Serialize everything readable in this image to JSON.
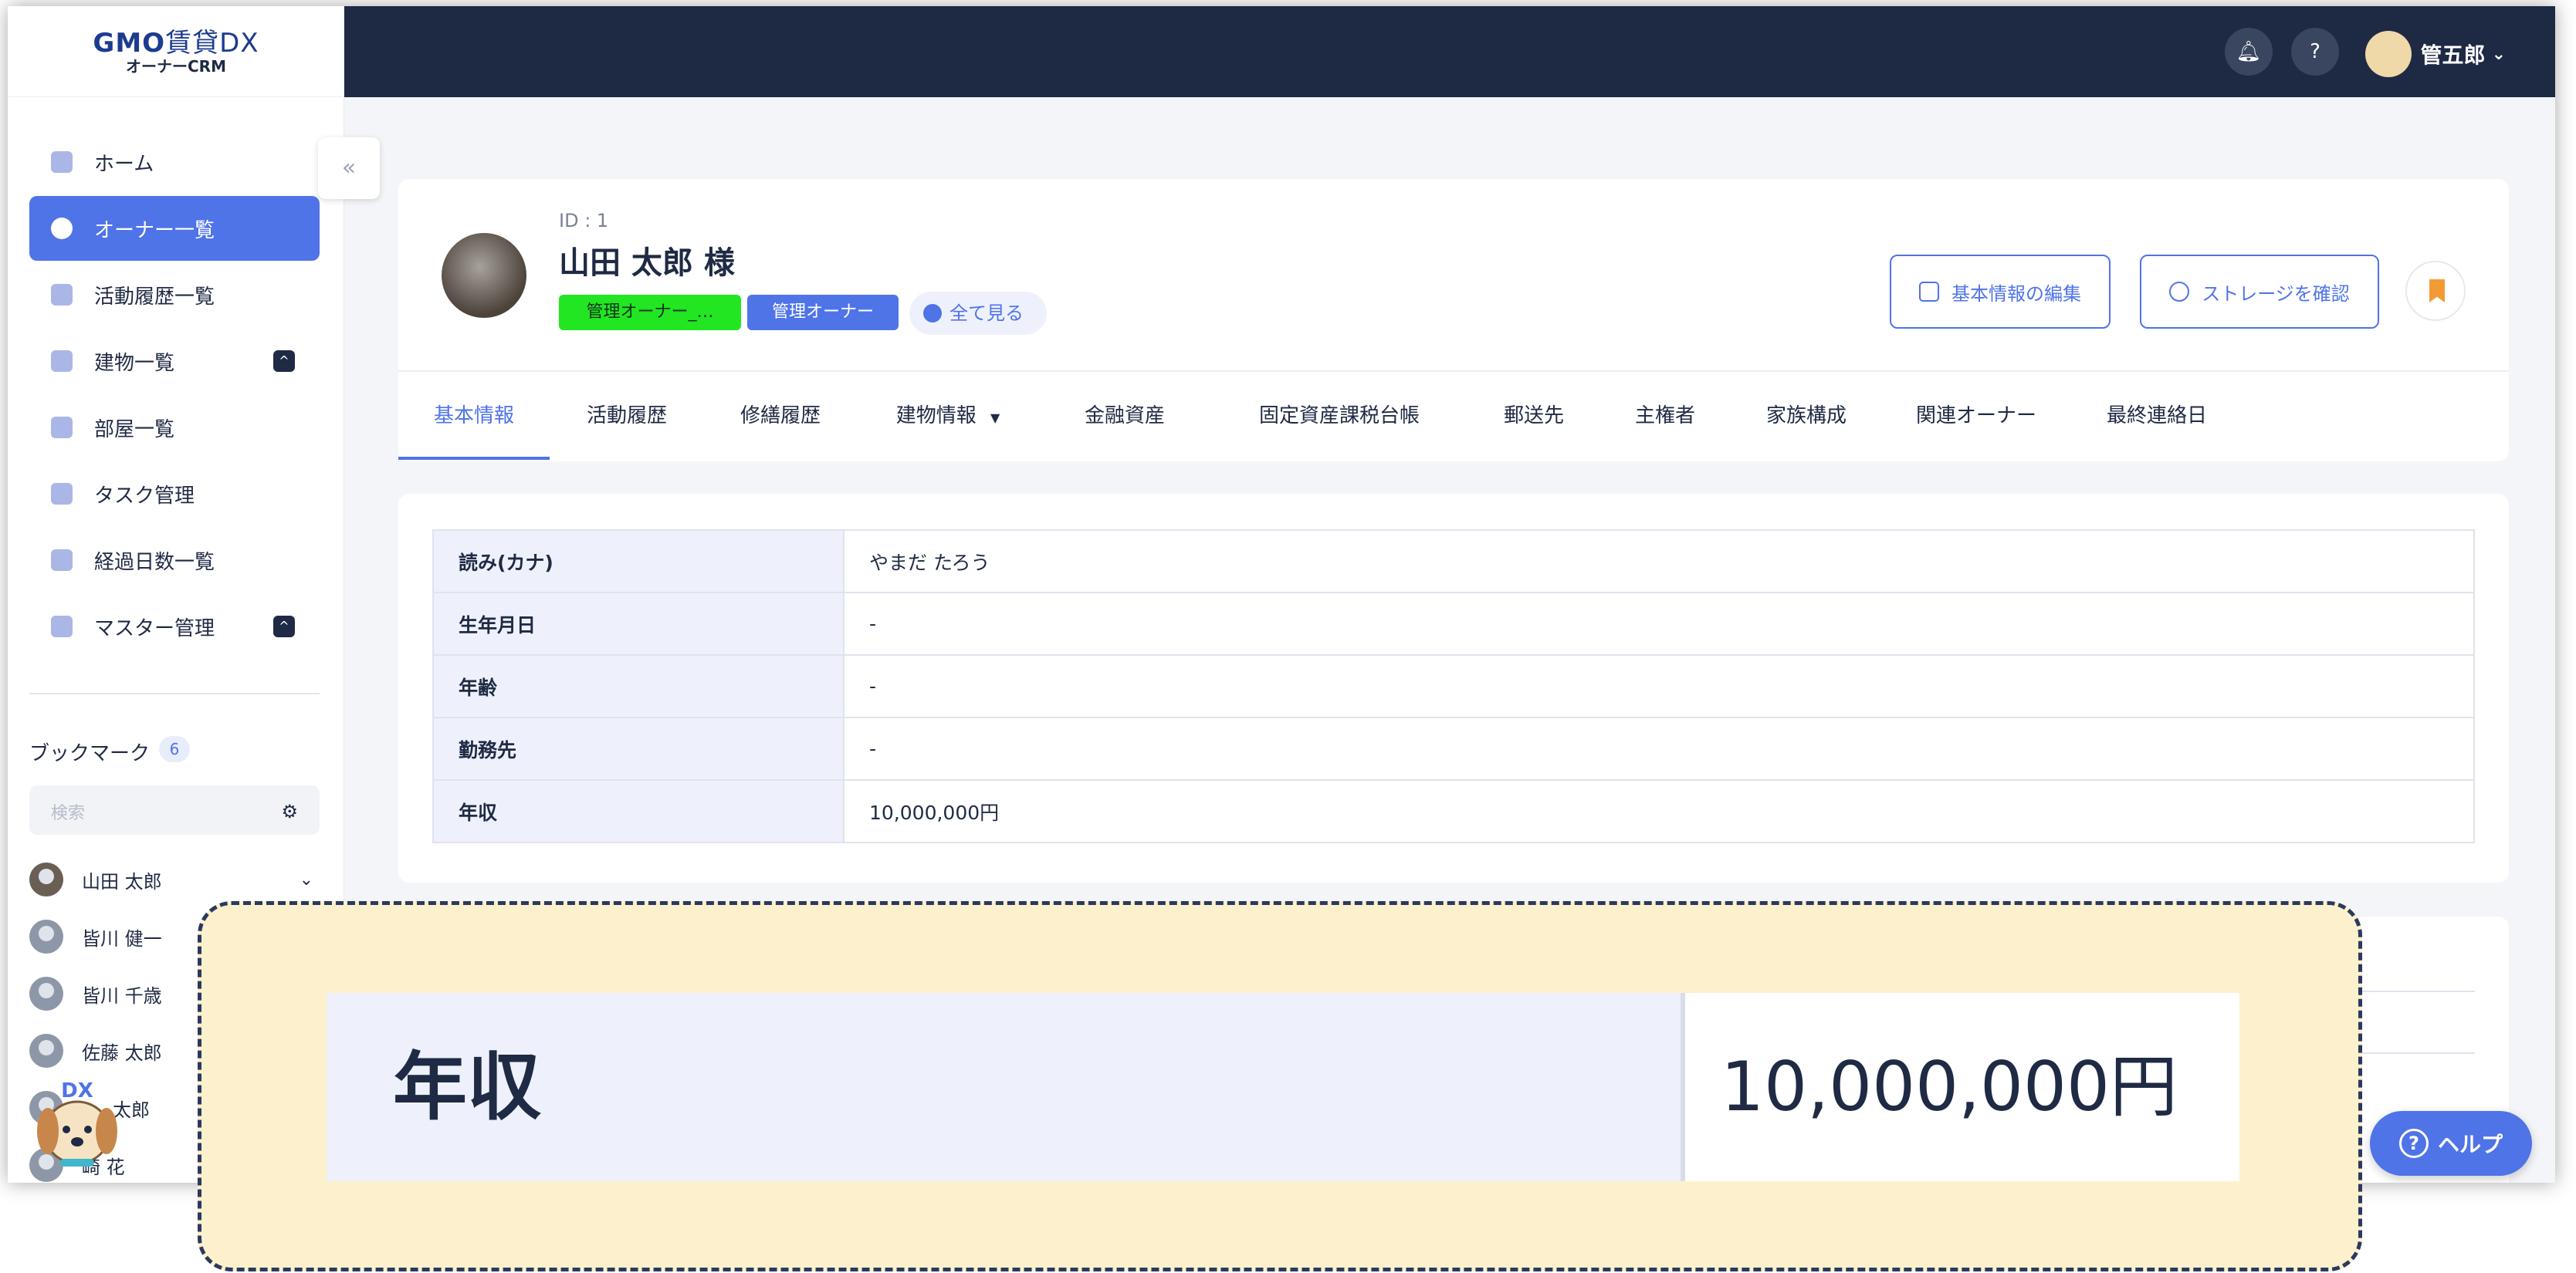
{
  "brand": {
    "name": "GMO",
    "product": "賃貸DX",
    "subtitle": "オーナーCRM"
  },
  "sidebar": {
    "items": [
      {
        "label": "ホーム"
      },
      {
        "label": "オーナー一覧"
      },
      {
        "label": "活動履歴一覧"
      },
      {
        "label": "建物一覧"
      },
      {
        "label": "部屋一覧"
      },
      {
        "label": "タスク管理"
      },
      {
        "label": "経過日数一覧"
      },
      {
        "label": "マスター管理"
      }
    ],
    "active_index": 1,
    "collapse_icon": "double-chevron-left-icon"
  },
  "bookmarks": {
    "title": "ブックマーク",
    "count": "6",
    "search_placeholder": "検索",
    "items": [
      {
        "name": "山田 太郎"
      },
      {
        "name": "皆川 健一"
      },
      {
        "name": "皆川 千歳"
      },
      {
        "name": "佐藤 太郎"
      },
      {
        "name": "太郎"
      },
      {
        "name": "崎 花"
      }
    ]
  },
  "mascot_text": "DX",
  "topbar": {
    "user_name": "管五郎"
  },
  "owner": {
    "id": "ID : 1",
    "name": "山田 太郎 様",
    "tags": [
      "管理オーナー_…",
      "管理オーナー"
    ],
    "see_all": "全て見る",
    "edit_button": "基本情報の編集",
    "storage_button": "ストレージを確認",
    "tag_colors": {
      "tag1": "#22e622",
      "tag2": "#4f74e8"
    }
  },
  "tabs": [
    "基本情報",
    "活動履歴",
    "修繕履歴",
    "建物情報",
    "金融資産",
    "固定資産課税台帳",
    "郵送先",
    "主権者",
    "家族構成",
    "関連オーナー",
    "最終連絡日"
  ],
  "info_rows": [
    {
      "key": "読み(カナ)",
      "value": "やまだ たろう"
    },
    {
      "key": "生年月日",
      "value": "-"
    },
    {
      "key": "年齢",
      "value": "-"
    },
    {
      "key": "勤務先",
      "value": "-"
    },
    {
      "key": "年収",
      "value": "10,000,000円"
    }
  ],
  "help_button": "ヘルプ",
  "callout": {
    "key": "年収",
    "value": "10,000,000円"
  },
  "colors": {
    "accent": "#4f74e8",
    "topbar": "#1e2a44",
    "callout_bg": "#fdf0cd"
  }
}
